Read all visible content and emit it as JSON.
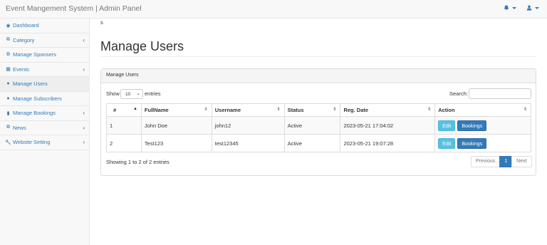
{
  "header": {
    "brand": "Event Mangement System | Admin Panel",
    "bell_icon": "bell-icon",
    "user_icon": "user-icon"
  },
  "sidebar": {
    "items": [
      {
        "label": "Dashboard",
        "icon": "dashboard-icon",
        "has_arrow": false
      },
      {
        "label": "Category",
        "icon": "category-icon",
        "has_arrow": true
      },
      {
        "label": "Manage Sponsers",
        "icon": "sponsors-icon",
        "has_arrow": false
      },
      {
        "label": "Events",
        "icon": "events-icon",
        "has_arrow": true
      },
      {
        "label": "Manage Users",
        "icon": "users-icon",
        "has_arrow": false,
        "active": true
      },
      {
        "label": "Manage Subscribers",
        "icon": "subscribers-icon",
        "has_arrow": false
      },
      {
        "label": "Manage Bookings",
        "icon": "bookings-icon",
        "has_arrow": true
      },
      {
        "label": "News",
        "icon": "news-icon",
        "has_arrow": true
      },
      {
        "label": "Website Setting",
        "icon": "wrench-icon",
        "has_arrow": true
      }
    ]
  },
  "main": {
    "stray_text": "s",
    "page_title": "Manage Users",
    "panel_heading": "Manage Users",
    "length": {
      "show": "Show",
      "value": "10",
      "entries": "entries"
    },
    "search": {
      "label": "Search:",
      "value": ""
    },
    "table": {
      "columns": [
        "#",
        "FullName",
        "Username",
        "Status",
        "Reg. Date",
        "Action"
      ],
      "rows": [
        {
          "num": "1",
          "fullname": "John Doe",
          "username": "john12",
          "status": "Active",
          "reg_date": "2023-05-21 17:04:02"
        },
        {
          "num": "2",
          "fullname": "Test123",
          "username": "test12345",
          "status": "Active",
          "reg_date": "2023-05-21 19:07:28"
        }
      ],
      "edit_label": "Edit",
      "bookings_label": "Bookings"
    },
    "info": "Showing 1 to 2 of 2 entries",
    "pagination": {
      "previous": "Previous",
      "current": "1",
      "next": "Next"
    }
  },
  "colors": {
    "link": "#337ab7",
    "info_button": "#5bc0de",
    "primary_button": "#337ab7"
  }
}
